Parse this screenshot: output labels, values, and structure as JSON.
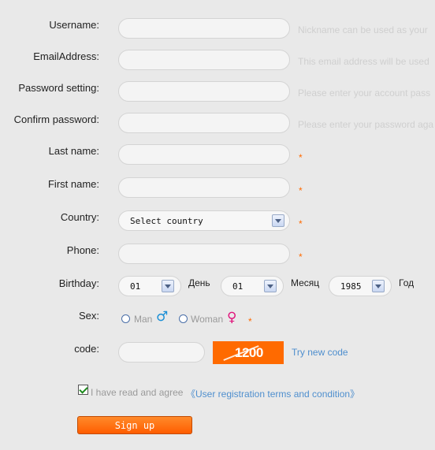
{
  "form": {
    "username": {
      "label": "Username:",
      "hint": "Nickname can be used as your"
    },
    "email": {
      "label": "EmailAddress:",
      "hint": "This email address will be used"
    },
    "password": {
      "label": "Password setting:",
      "hint": "Please enter your account pass"
    },
    "confirm": {
      "label": "Confirm password:",
      "hint": "Please enter your password aga"
    },
    "last_name": {
      "label": "Last name:"
    },
    "first_name": {
      "label": "First name:"
    },
    "country": {
      "label": "Country:",
      "selected": "Select country"
    },
    "phone": {
      "label": "Phone:"
    },
    "birthday": {
      "label": "Birthday:",
      "day_value": "01",
      "day_label": "День",
      "month_value": "01",
      "month_label": "Месяц",
      "year_value": "1985",
      "year_label": "Год"
    },
    "sex": {
      "label": "Sex:",
      "man": "Man",
      "woman": "Woman",
      "man_symbol": "♂",
      "woman_symbol": "♀"
    },
    "code": {
      "label": "code:",
      "captcha": "1200",
      "try_new": "Try new code"
    },
    "agree": {
      "text": "I have read and agree ",
      "terms": "《User registration terms and condition》"
    },
    "required_mark": "*",
    "submit": "Sign up"
  },
  "colors": {
    "accent": "#ff6a00",
    "link": "#4f8fce",
    "male": "#1a8fd6",
    "female": "#e0157c"
  }
}
